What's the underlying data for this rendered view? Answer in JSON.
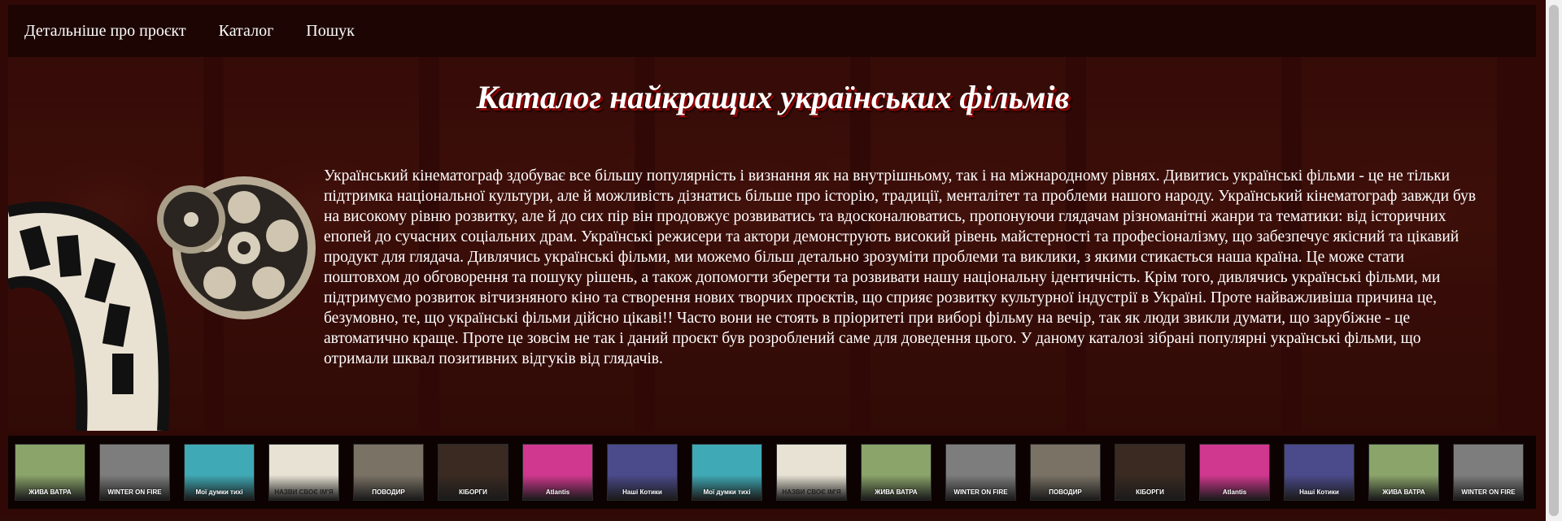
{
  "nav": {
    "items": [
      "Детальніше про проєкт",
      "Каталог",
      "Пошук"
    ]
  },
  "page": {
    "title": "Каталог найкращих українських фільмів",
    "intro": "Український кінематограф здобуває все більшу популярність і визнання як на внутрішньому, так і на міжнародному рівнях. Дивитись українські фільми - це не тільки підтримка національної культури, але й можливість дізнатись більше про історію, традиції, менталітет та проблеми нашого народу. Український кінематограф завжди був на високому рівню розвитку, але й до сих пір він продовжує розвиватись та вдосконалюватись, пропонуючи глядачам різноманітні жанри та тематики: від історичних епопей до сучасних соціальних драм. Українські режисери та актори демонструють високий рівень майстерності та професіоналізму, що забезпечує якісний та цікавий продукт для глядача. Дивлячись українські фільми, ми можемо більш детально зрозуміти проблеми та виклики, з якими стикається наша країна. Це може стати поштовхом до обговорення та пошуку рішень, а також допомогти зберегти та розвивати нашу національну ідентичність. Крім того, дивлячись українські фільми, ми підтримуємо розвиток вітчизняного кіно та створення нових творчих проєктів, що сприяє розвитку культурної індустрії в Україні. Проте найважливіша причина це, безумовно, те, що українські фільми дійсно цікаві!! Часто вони не стоять в пріоритеті при виборі фільму на вечір, так як люди звикли думати, що зарубіжне - це автоматично краще. Проте це зовсім не так і даний проєкт був розроблений саме для доведення цього. У даному каталозі зібрані популярні українські фільми, що отримали шквал позитивних відгуків від глядачів."
  },
  "posters": [
    {
      "title": "ЖИВА ВАТРА",
      "bg": "#8aa46a",
      "dark": false
    },
    {
      "title": "WINTER ON FIRE",
      "bg": "#7d7d7d",
      "dark": false
    },
    {
      "title": "Мої думки тихі",
      "bg": "#3fa9b5",
      "dark": false
    },
    {
      "title": "НАЗВИ СВОЄ ІМ'Я",
      "bg": "#e8e2d4",
      "dark": true
    },
    {
      "title": "ПОВОДИР",
      "bg": "#7a7265",
      "dark": false
    },
    {
      "title": "КІБОРГИ",
      "bg": "#3a2a22",
      "dark": false
    },
    {
      "title": "Atlantis",
      "bg": "#d0388f",
      "dark": false
    },
    {
      "title": "Наші Котики",
      "bg": "#4b4a8a",
      "dark": false
    },
    {
      "title": "Мої думки тихі",
      "bg": "#3fa9b5",
      "dark": false
    },
    {
      "title": "НАЗВИ СВОЄ ІМ'Я",
      "bg": "#e8e2d4",
      "dark": true
    },
    {
      "title": "ЖИВА ВАТРА",
      "bg": "#8aa46a",
      "dark": false
    },
    {
      "title": "WINTER ON FIRE",
      "bg": "#7d7d7d",
      "dark": false
    },
    {
      "title": "ПОВОДИР",
      "bg": "#7a7265",
      "dark": false
    },
    {
      "title": "КІБОРГИ",
      "bg": "#3a2a22",
      "dark": false
    },
    {
      "title": "Atlantis",
      "bg": "#d0388f",
      "dark": false
    },
    {
      "title": "Наші Котики",
      "bg": "#4b4a8a",
      "dark": false
    },
    {
      "title": "ЖИВА ВАТРА",
      "bg": "#8aa46a",
      "dark": false
    },
    {
      "title": "WINTER ON FIRE",
      "bg": "#7d7d7d",
      "dark": false
    }
  ]
}
